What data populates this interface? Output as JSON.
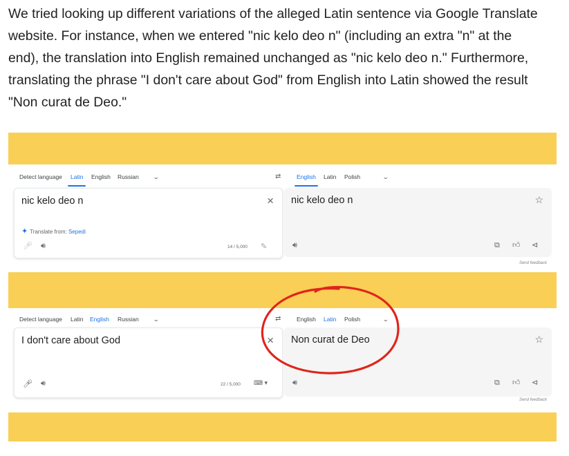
{
  "article": {
    "paragraph": [
      "We tried looking up different variations of the alleged Latin sentence via Google Translate",
      "website. For instance, when we entered \"nic kelo deo n\" (including an extra \"n\" at the",
      "end), the translation into English remained unchanged as \"nic kelo deo n.\" Furthermore,",
      "translating the phrase \"I don't care about God\" from English into Latin showed the result",
      "\"Non curat de Deo.\""
    ]
  },
  "colors": {
    "band": "#f9cf55",
    "accent": "#1a73e8",
    "circle": "#e0251b"
  },
  "shot1": {
    "source_langs": [
      "Detect language",
      "Latin",
      "English",
      "Russian"
    ],
    "target_langs": [
      "English",
      "Latin",
      "Polish"
    ],
    "input_text": "nic kelo deo n",
    "output_text": "nic kelo deo n",
    "hint_prefix": "Translate from:",
    "hint_lang": "Sepedi",
    "char_count": "14 / 5,000",
    "feedback": "Send feedback"
  },
  "shot2": {
    "source_langs": [
      "Detect language",
      "Latin",
      "English",
      "Russian"
    ],
    "target_langs": [
      "English",
      "Latin",
      "Polish"
    ],
    "input_text": "I don't care about God",
    "output_text": "Non curat de Deo",
    "char_count": "22 / 5,000",
    "feedback": "Send feedback"
  },
  "icons": {
    "chevron": "chevron-down-icon",
    "swap": "swap-icon",
    "close": "close-icon",
    "star": "star-icon",
    "mic": "mic-icon",
    "speaker": "speaker-icon",
    "copy": "copy-icon",
    "rate": "rate-icon",
    "share": "share-icon",
    "sparkle": "sparkle-icon",
    "pencil": "pencil-icon",
    "keyboard": "keyboard-icon"
  }
}
